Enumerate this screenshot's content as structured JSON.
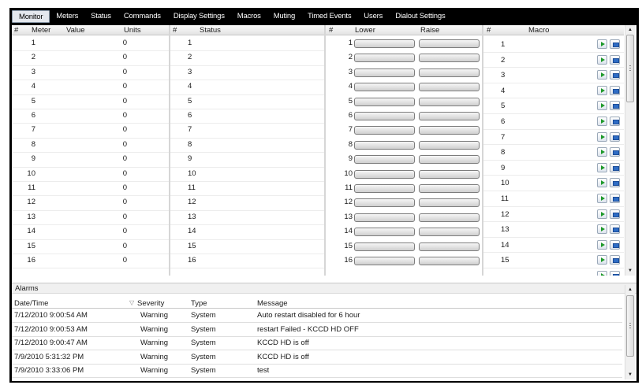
{
  "menu": [
    {
      "label": "Monitor",
      "active": true
    },
    {
      "label": "Meters"
    },
    {
      "label": "Status"
    },
    {
      "label": "Commands"
    },
    {
      "label": "Display Settings"
    },
    {
      "label": "Macros"
    },
    {
      "label": "Muting"
    },
    {
      "label": "Timed Events"
    },
    {
      "label": "Users"
    },
    {
      "label": "Dialout Settings"
    }
  ],
  "meters": {
    "headers": {
      "num": "#",
      "meter": "Meter",
      "value": "Value",
      "units": "Units"
    },
    "rows": [
      {
        "num": "1",
        "value": "0"
      },
      {
        "num": "2",
        "value": "0"
      },
      {
        "num": "3",
        "value": "0"
      },
      {
        "num": "4",
        "value": "0"
      },
      {
        "num": "5",
        "value": "0"
      },
      {
        "num": "6",
        "value": "0"
      },
      {
        "num": "7",
        "value": "0"
      },
      {
        "num": "8",
        "value": "0"
      },
      {
        "num": "9",
        "value": "0"
      },
      {
        "num": "10",
        "value": "0"
      },
      {
        "num": "11",
        "value": "0"
      },
      {
        "num": "12",
        "value": "0"
      },
      {
        "num": "13",
        "value": "0"
      },
      {
        "num": "14",
        "value": "0"
      },
      {
        "num": "15",
        "value": "0"
      },
      {
        "num": "16",
        "value": "0"
      }
    ]
  },
  "status": {
    "headers": {
      "num": "#",
      "status": "Status"
    },
    "rows": [
      "1",
      "2",
      "3",
      "4",
      "5",
      "6",
      "7",
      "8",
      "9",
      "10",
      "11",
      "12",
      "13",
      "14",
      "15",
      "16"
    ]
  },
  "commands": {
    "headers": {
      "num": "#",
      "lower": "Lower",
      "raise": "Raise"
    },
    "rows": [
      "1",
      "2",
      "3",
      "4",
      "5",
      "6",
      "7",
      "8",
      "9",
      "10",
      "11",
      "12",
      "13",
      "14",
      "15",
      "16"
    ]
  },
  "macros": {
    "headers": {
      "num": "#",
      "macro": "Macro"
    },
    "rows": [
      "1",
      "2",
      "3",
      "4",
      "5",
      "6",
      "7",
      "8",
      "9",
      "10",
      "11",
      "12",
      "13",
      "14",
      "15"
    ],
    "icons": {
      "run": "play-icon",
      "edit": "edit-icon"
    }
  },
  "alarms": {
    "title": "Alarms",
    "headers": {
      "datetime": "Date/Time",
      "sort": "▽",
      "severity": "Severity",
      "type": "Type",
      "message": "Message"
    },
    "rows": [
      {
        "datetime": "7/12/2010 9:00:54 AM",
        "severity": "Warning",
        "type": "System",
        "message": "Auto restart disabled for 6 hour"
      },
      {
        "datetime": "7/12/2010 9:00:53 AM",
        "severity": "Warning",
        "type": "System",
        "message": "restart Failed - KCCD HD OFF"
      },
      {
        "datetime": "7/12/2010 9:00:47 AM",
        "severity": "Warning",
        "type": "System",
        "message": "KCCD HD is off"
      },
      {
        "datetime": "7/9/2010 5:31:32 PM",
        "severity": "Warning",
        "type": "System",
        "message": "KCCD HD is off"
      },
      {
        "datetime": "7/9/2010 3:33:06 PM",
        "severity": "Warning",
        "type": "System",
        "message": "test"
      }
    ]
  },
  "colors": {
    "menubar": "#000000",
    "active_tab": "#e4e8ee",
    "play": "#1f9a2c",
    "edit": "#2e6cc4"
  }
}
